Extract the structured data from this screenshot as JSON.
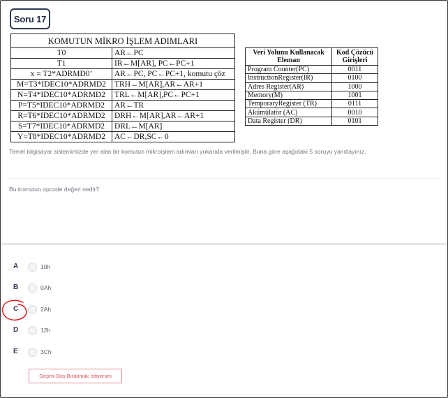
{
  "question": {
    "badge": "Soru 17",
    "instruction": "Temel bilgisayar sistemimizde yer alan bir komutun mikroişlem adımları yukarıda verilmiştir. Buna göre aşağıdaki 5 soruyu yanıtlayınız.",
    "prompt": "Bu komutun opcode değeri nedir?"
  },
  "micro_table": {
    "title": "KOMUTUN MİKRO İŞLEM ADIMLARI",
    "rows": [
      {
        "cond": "T0",
        "op": "AR←PC"
      },
      {
        "cond": "T1",
        "op": "IR←M[AR], PC←PC+1"
      },
      {
        "cond": "x = T2*ADRMD0’",
        "op": "AR←PC, PC←PC+1, komutu çöz"
      },
      {
        "cond": "M=T3*IDEC10*ADRMD2",
        "op": "TRH←M[AR],AR←AR+1"
      },
      {
        "cond": "N=T4*IDEC10*ADRMD2",
        "op": "TRL←M[AR],PC←PC+1"
      },
      {
        "cond": "P=T5*IDEC10*ADRMD2",
        "op": "AR←TR"
      },
      {
        "cond": "R=T6*IDEC10*ADRMD2",
        "op": "DRH←M[AR],AR←AR+1"
      },
      {
        "cond": "S=T7*IDEC10*ADRMD2",
        "op": "DRL←M[AR]"
      },
      {
        "cond": "Y=T8*IDEC10*ADRMD2",
        "op": "AC←DR,SC←0"
      }
    ]
  },
  "code_table": {
    "header_element": "Veri Yolunu Kullanacak Eleman",
    "header_code": "Kod Çözücü Girişleri",
    "rows": [
      {
        "element": "Program Counter(PC)",
        "code": "0011"
      },
      {
        "element": "InstructionRegister(IR)",
        "code": "0100"
      },
      {
        "element": "Adres Register(AR)",
        "code": "1000"
      },
      {
        "element": "Memory(M)",
        "code": "1001"
      },
      {
        "element": "TemporaryRegister (TR)",
        "code": "0111"
      },
      {
        "element": "Akümülatör (AC)",
        "code": "0010"
      },
      {
        "element": "Data Register (DR)",
        "code": "0101"
      }
    ]
  },
  "options": [
    {
      "letter": "A",
      "value": "10h"
    },
    {
      "letter": "B",
      "value": "0Ah"
    },
    {
      "letter": "C",
      "value": "2Ah"
    },
    {
      "letter": "D",
      "value": "12h"
    },
    {
      "letter": "E",
      "value": "3Ch"
    }
  ],
  "clear_button": "Seçimi Boş Bırakmak İstiyorum",
  "colors": {
    "accent_red": "#d94f55",
    "text_muted": "#6e7684",
    "badge_border": "#2f3a52",
    "handwritten_circle": "#e01010"
  }
}
